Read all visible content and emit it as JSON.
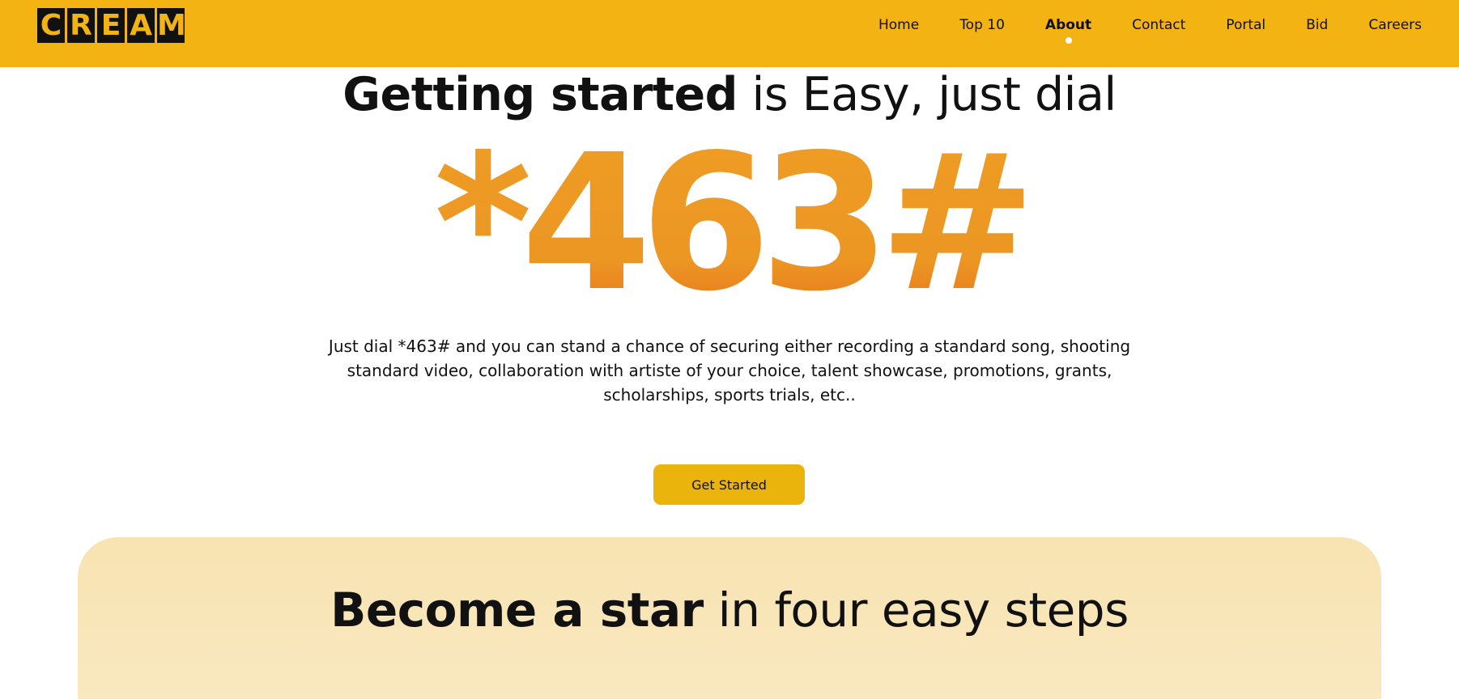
{
  "header": {
    "logo_letters": [
      "C",
      "R",
      "E",
      "A",
      "M"
    ],
    "nav": [
      {
        "label": "Home",
        "active": false
      },
      {
        "label": "Top 10",
        "active": false
      },
      {
        "label": "About",
        "active": true
      },
      {
        "label": "Contact",
        "active": false
      },
      {
        "label": "Portal",
        "active": false
      },
      {
        "label": "Bid",
        "active": false
      },
      {
        "label": "Careers",
        "active": false
      }
    ]
  },
  "hero": {
    "title_bold": "Getting started",
    "title_rest": " is Easy, just dial",
    "dial_code": "*463#",
    "description": "Just dial *463# and you can stand a chance of securing either recording a standard song, shooting standard video, collaboration with artiste of your choice, talent showcase, promotions, grants, scholarships, sports trials, etc..",
    "cta_label": "Get Started"
  },
  "steps": {
    "title_bold": "Become a star",
    "title_rest": " in four easy steps"
  },
  "colors": {
    "header_bg": "#f3b313",
    "dial_code_gradient_top": "#ee9d25",
    "dial_code_gradient_bottom": "#e8751c",
    "cta_bg": "#eab40c",
    "steps_panel_bg": "#f8e3b1"
  }
}
